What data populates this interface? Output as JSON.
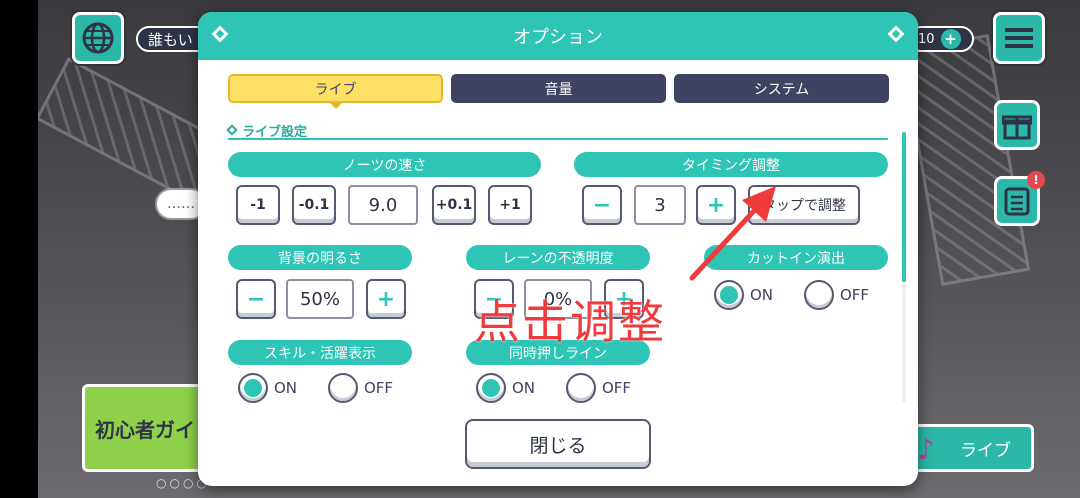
{
  "background": {
    "chat_pill": "誰もい",
    "coin_count": "10",
    "guide_label": "初心者ガイ",
    "live_label": "ライブ",
    "speech_dots": "……",
    "page_dots": "○○○○"
  },
  "dialog": {
    "title": "オプション",
    "tabs": [
      {
        "label": "ライブ",
        "active": true
      },
      {
        "label": "音量",
        "active": false
      },
      {
        "label": "システム",
        "active": false
      }
    ],
    "section_title": "ライブ設定",
    "note_speed": {
      "label": "ノーツの速さ",
      "buttons": [
        "-1",
        "-0.1",
        "+0.1",
        "+1"
      ],
      "value": "9.0"
    },
    "timing": {
      "label": "タイミング調整",
      "minus": "−",
      "plus": "+",
      "value": "3",
      "tap_button": "タップで調整"
    },
    "brightness": {
      "label": "背景の明るさ",
      "minus": "−",
      "plus": "+",
      "value": "50%"
    },
    "lane_opacity": {
      "label": "レーンの不透明度",
      "minus": "−",
      "plus": "+",
      "value": "0%"
    },
    "cut_in": {
      "label": "カットイン演出",
      "on": "ON",
      "off": "OFF",
      "selected": "ON"
    },
    "skill_display": {
      "label": "スキル・活躍表示",
      "on": "ON",
      "off": "OFF",
      "selected": "ON"
    },
    "simul_line": {
      "label": "同時押しライン",
      "on": "ON",
      "off": "OFF",
      "selected": "ON"
    },
    "close_button": "閉じる"
  },
  "annotation": {
    "text": "点击调整",
    "color": "#ef3b3b"
  },
  "colors": {
    "accent": "#2ec4b6",
    "tab_dark": "#3f4260",
    "tab_active": "#ffe066"
  }
}
